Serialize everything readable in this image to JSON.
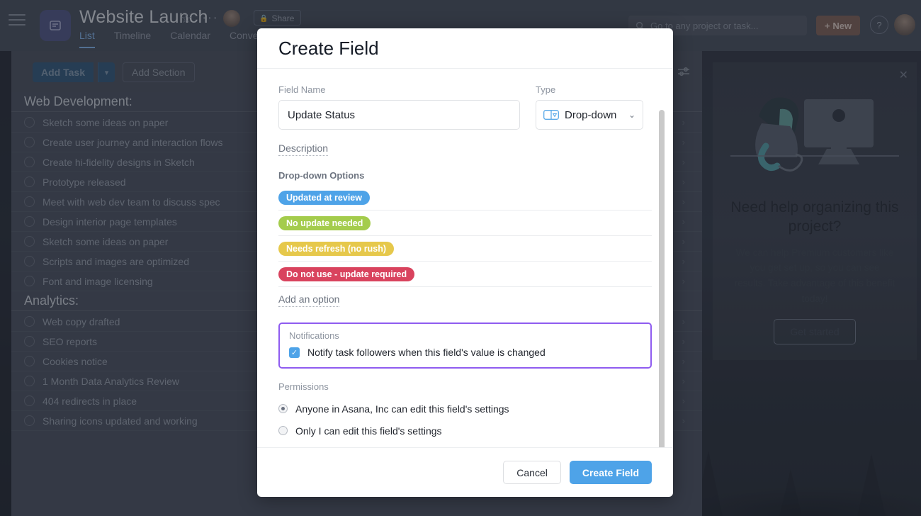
{
  "topbar": {
    "menu_icon": "hamburger-icon",
    "project_icon": "project-board-icon",
    "project_title": "Website Launch",
    "star_icon": "star-icon",
    "more_icon": "ellipsis-icon",
    "avatar": "user-avatar",
    "share_label": "Share",
    "lock_icon": "lock-icon",
    "tabs": [
      {
        "label": "List",
        "active": true
      },
      {
        "label": "Timeline",
        "active": false
      },
      {
        "label": "Calendar",
        "active": false
      },
      {
        "label": "Conversations",
        "active": false
      }
    ],
    "search_placeholder": "Go to any project or task...",
    "search_icon": "search-icon",
    "new_label": "New",
    "plus_icon": "plus-icon",
    "help_label": "?",
    "profile_avatar": "profile-avatar"
  },
  "toolbar": {
    "add_task_label": "Add Task",
    "add_task_caret": "chevron-down-icon",
    "add_section_label": "Add Section",
    "filter_icon": "filter-sliders-icon"
  },
  "tasklist": {
    "sections": [
      {
        "title": "Web Development:",
        "tasks": [
          "Sketch some ideas on paper",
          "Create user journey and interaction flows",
          "Create hi-fidelity designs in Sketch",
          "Prototype released",
          "Meet with web dev team to discuss spec",
          "Design interior page templates",
          "Sketch some ideas on paper",
          "Scripts and images are optimized",
          "Font and image licensing"
        ]
      },
      {
        "title": "Analytics:",
        "tasks": [
          "Web copy drafted",
          "SEO reports",
          "Cookies notice",
          "1 Month Data Analytics Review",
          "404 redirects in place",
          "Sharing icons updated and working"
        ]
      }
    ]
  },
  "help_panel": {
    "close_icon": "close-icon",
    "illustration": "person-at-computer-illustration",
    "title": "Need help organizing this project?",
    "body": "We can help Premium customers like you get set up, so you can see results. Take advantage of this benefit today!",
    "cta_label": "Get started"
  },
  "modal": {
    "title": "Create Field",
    "field_name_label": "Field Name",
    "field_name_value": "Update Status",
    "field_name_placeholder": "Field Name",
    "type_label": "Type",
    "type_value": "Drop-down",
    "type_icon": "drop-down-field-icon",
    "type_caret_icon": "chevron-down-icon",
    "description_label": "Description",
    "options_label": "Drop-down Options",
    "options": [
      {
        "label": "Updated at review",
        "color": "#4ea3e8"
      },
      {
        "label": "No update needed",
        "color": "#a4cc4c"
      },
      {
        "label": "Needs refresh (no rush)",
        "color": "#e6c84b"
      },
      {
        "label": "Do not use - update required",
        "color": "#d9435e"
      }
    ],
    "add_option_label": "Add an option",
    "notifications_label": "Notifications",
    "notify_checkbox_label": "Notify task followers when this field's value is changed",
    "notify_checked": true,
    "notify_highlight_color": "#8f5cf0",
    "permissions_label": "Permissions",
    "permissions": [
      {
        "label": "Anyone in Asana, Inc can edit this field's settings",
        "selected": true
      },
      {
        "label": "Only I can edit this field's settings",
        "selected": false
      }
    ],
    "cancel_label": "Cancel",
    "submit_label": "Create Field",
    "accent_color": "#4ea3e8",
    "scrollbar": "vertical-scrollbar"
  }
}
